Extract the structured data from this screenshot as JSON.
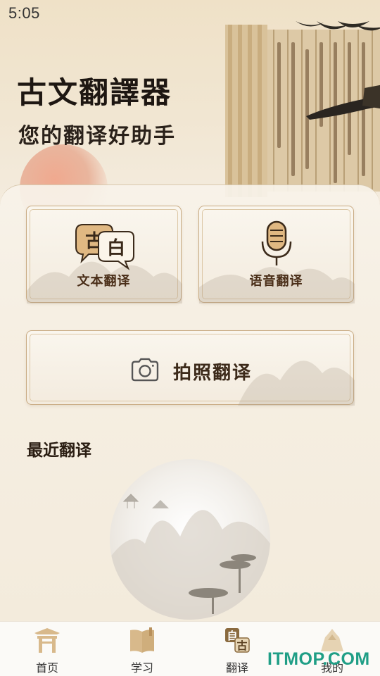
{
  "status_bar": {
    "time": "5:05"
  },
  "header": {
    "title": "古文翻譯器",
    "subtitle": "您的翻译好助手"
  },
  "features": {
    "text_translate": {
      "label": "文本翻译",
      "icon_glyph_1": "古",
      "icon_glyph_2": "白"
    },
    "voice_translate": {
      "label": "语音翻译"
    },
    "photo_translate": {
      "label": "拍照翻译"
    }
  },
  "recent": {
    "title": "最近翻译"
  },
  "bottom_nav": {
    "items": [
      {
        "label": "首页",
        "icon": "home-gate-icon"
      },
      {
        "label": "学习",
        "icon": "book-icon"
      },
      {
        "label": "翻译",
        "icon": "translate-icon",
        "icon_glyph_1": "自",
        "icon_glyph_2": "古"
      },
      {
        "label": "我的",
        "icon": "profile-mountain-icon"
      }
    ]
  },
  "watermark": "ITMOP.COM",
  "colors": {
    "background": "#f3ebdc",
    "card_border": "#c9ab83",
    "title_text": "#1e1712",
    "label_text": "#4a2e18",
    "watermark": "#1f9e86"
  }
}
